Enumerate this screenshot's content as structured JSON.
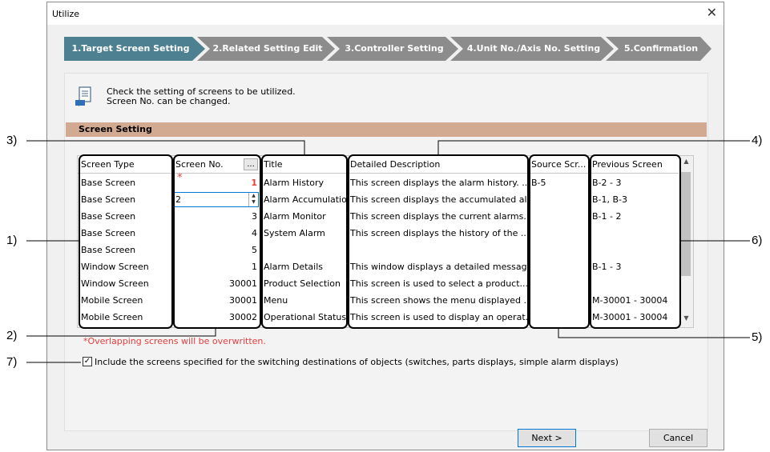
{
  "window": {
    "title": "Utilize",
    "close_icon": "close-icon"
  },
  "steps": [
    {
      "label": "1.Target Screen Setting",
      "active": true
    },
    {
      "label": "2.Related Setting Edit",
      "active": false
    },
    {
      "label": "3.Controller Setting",
      "active": false
    },
    {
      "label": "4.Unit No./Axis No. Setting",
      "active": false
    },
    {
      "label": "5.Confirmation",
      "active": false
    }
  ],
  "info": {
    "icon": "document-import-icon",
    "line1": "Check the setting of screens to be utilized.",
    "line2": "Screen No. can be changed."
  },
  "section": {
    "title": "Screen Setting"
  },
  "table": {
    "headers": {
      "screen_type": "Screen Type",
      "screen_no": "Screen No.",
      "screen_no_button": "...",
      "title": "Title",
      "description": "Detailed Description",
      "source": "Source Scr...",
      "previous": "Previous Screen"
    },
    "rows": [
      {
        "type": "Base Screen",
        "no": "1",
        "title": "Alarm History",
        "desc": "This screen displays the alarm history. ...",
        "source": "B-5",
        "prev": "B-2 - 3",
        "marker": "*"
      },
      {
        "type": "Base Screen",
        "no": "2",
        "title": "Alarm Accumulation",
        "desc": "This screen displays the accumulated al...",
        "source": "",
        "prev": "B-1, B-3"
      },
      {
        "type": "Base Screen",
        "no": "3",
        "title": "Alarm Monitor",
        "desc": "This screen displays the current alarms....",
        "source": "",
        "prev": "B-1 - 2"
      },
      {
        "type": "Base Screen",
        "no": "4",
        "title": "System Alarm",
        "desc": "This screen displays the history of the ...",
        "source": "",
        "prev": ""
      },
      {
        "type": "Base Screen",
        "no": "5",
        "title": "",
        "desc": "",
        "source": "",
        "prev": ""
      },
      {
        "type": "Window Screen",
        "no": "1",
        "title": "Alarm Details",
        "desc": "This window displays a detailed messag...",
        "source": "",
        "prev": "B-1 - 3"
      },
      {
        "type": "Window Screen",
        "no": "30001",
        "title": "Product Selection",
        "desc": "This screen is used to select a product...",
        "source": "",
        "prev": ""
      },
      {
        "type": "Mobile Screen",
        "no": "30001",
        "title": "Menu",
        "desc": "This screen shows the menu displayed ...",
        "source": "",
        "prev": "M-30001 - 30004"
      },
      {
        "type": "Mobile Screen",
        "no": "30002",
        "title": "Operational Status",
        "desc": "This screen is used to display an operat...",
        "source": "",
        "prev": "M-30001 - 30004"
      }
    ]
  },
  "warning": "*Overlapping screens will be overwritten.",
  "checkbox": {
    "checked": true,
    "label": "Include the screens specified for the switching destinations of objects (switches, parts displays, simple alarm displays)"
  },
  "buttons": {
    "next": "Next >",
    "cancel": "Cancel"
  },
  "callouts": [
    "1)",
    "2)",
    "3)",
    "4)",
    "5)",
    "6)",
    "7)"
  ],
  "colors": {
    "active_step": "#4d8191",
    "inactive_step": "#8c8c8c",
    "section_bar": "#d2a991",
    "warning": "#e63f3f"
  }
}
